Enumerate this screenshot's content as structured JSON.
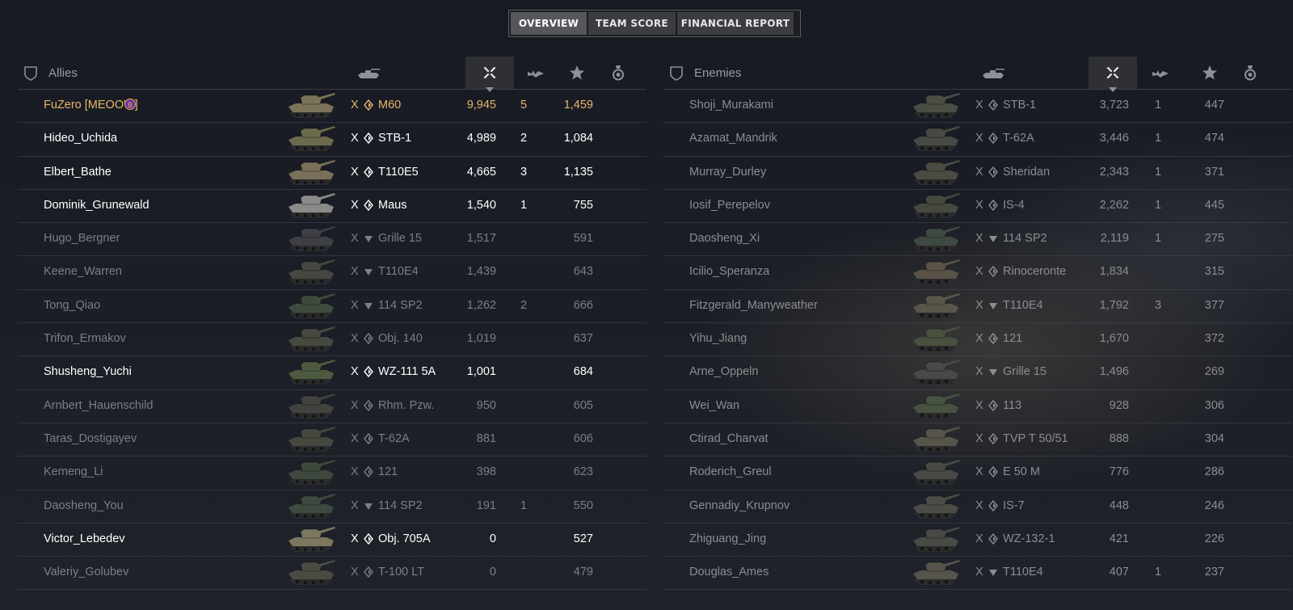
{
  "tabs": [
    {
      "label": "OVERVIEW",
      "active": true
    },
    {
      "label": "TEAM SCORE",
      "active": false
    },
    {
      "label": "FINANCIAL REPORT",
      "active": false
    }
  ],
  "allies": {
    "title": "Allies",
    "rows": [
      {
        "name": "FuZero [MEOOW]",
        "tier": "X",
        "vehicle": "M60",
        "damage": "9,945",
        "kills": "5",
        "xp": "1,459",
        "state": "player",
        "cls": "diamond",
        "camo": "#7a7358"
      },
      {
        "name": "Hideo_Uchida",
        "tier": "X",
        "vehicle": "STB-1",
        "damage": "4,989",
        "kills": "2",
        "xp": "1,084",
        "state": "alive",
        "cls": "diamond",
        "camo": "#6b6a4c"
      },
      {
        "name": "Elbert_Bathe",
        "tier": "X",
        "vehicle": "T110E5",
        "damage": "4,665",
        "kills": "3",
        "xp": "1,135",
        "state": "alive",
        "cls": "diamond",
        "camo": "#7a6f58"
      },
      {
        "name": "Dominik_Grunewald",
        "tier": "X",
        "vehicle": "Maus",
        "damage": "1,540",
        "kills": "1",
        "xp": "755",
        "state": "alive",
        "cls": "diamond",
        "camo": "#8a8a88"
      },
      {
        "name": "Hugo_Bergner",
        "tier": "X",
        "vehicle": "Grille 15",
        "damage": "1,517",
        "kills": "",
        "xp": "591",
        "state": "dead",
        "cls": "triangle",
        "camo": "#3e3f45"
      },
      {
        "name": "Keene_Warren",
        "tier": "X",
        "vehicle": "T110E4",
        "damage": "1,439",
        "kills": "",
        "xp": "643",
        "state": "dead",
        "cls": "triangle",
        "camo": "#464740"
      },
      {
        "name": "Tong_Qiao",
        "tier": "X",
        "vehicle": "114 SP2",
        "damage": "1,262",
        "kills": "2",
        "xp": "666",
        "state": "dead",
        "cls": "triangle",
        "camo": "#3f4a3e"
      },
      {
        "name": "Trifon_Ermakov",
        "tier": "X",
        "vehicle": "Obj. 140",
        "damage": "1,019",
        "kills": "",
        "xp": "637",
        "state": "dead",
        "cls": "diamond",
        "camo": "#46493f"
      },
      {
        "name": "Shusheng_Yuchi",
        "tier": "X",
        "vehicle": "WZ-111 5A",
        "damage": "1,001",
        "kills": "",
        "xp": "684",
        "state": "alive",
        "cls": "diamond",
        "camo": "#4d5a3f"
      },
      {
        "name": "Arnbert_Hauenschild",
        "tier": "X",
        "vehicle": "Rhm. Pzw.",
        "damage": "950",
        "kills": "",
        "xp": "605",
        "state": "dead",
        "cls": "diamond",
        "camo": "#42433f"
      },
      {
        "name": "Taras_Dostigayev",
        "tier": "X",
        "vehicle": "T-62A",
        "damage": "881",
        "kills": "",
        "xp": "606",
        "state": "dead",
        "cls": "diamond",
        "camo": "#45483f"
      },
      {
        "name": "Kemeng_Li",
        "tier": "X",
        "vehicle": "121",
        "damage": "398",
        "kills": "",
        "xp": "623",
        "state": "dead",
        "cls": "diamond",
        "camo": "#3f483c"
      },
      {
        "name": "Daosheng_You",
        "tier": "X",
        "vehicle": "114 SP2",
        "damage": "191",
        "kills": "1",
        "xp": "550",
        "state": "dead",
        "cls": "triangle",
        "camo": "#3c4a40"
      },
      {
        "name": "Victor_Lebedev",
        "tier": "X",
        "vehicle": "Obj. 705A",
        "damage": "0",
        "kills": "",
        "xp": "527",
        "state": "alive",
        "cls": "diamond",
        "camo": "#7c7860"
      },
      {
        "name": "Valeriy_Golubev",
        "tier": "X",
        "vehicle": "T-100 LT",
        "damage": "0",
        "kills": "",
        "xp": "479",
        "state": "dead",
        "cls": "diamond",
        "camo": "#4a4b43"
      }
    ]
  },
  "enemies": {
    "title": "Enemies",
    "rows": [
      {
        "name": "Shoji_Murakami",
        "tier": "X",
        "vehicle": "STB-1",
        "damage": "3,723",
        "kills": "1",
        "xp": "447",
        "cls": "diamond",
        "camo": "#4a4d44"
      },
      {
        "name": "Azamat_Mandrik",
        "tier": "X",
        "vehicle": "T-62A",
        "damage": "3,446",
        "kills": "1",
        "xp": "474",
        "cls": "diamond",
        "camo": "#474a42"
      },
      {
        "name": "Murray_Durley",
        "tier": "X",
        "vehicle": "Sheridan",
        "damage": "2,343",
        "kills": "1",
        "xp": "371",
        "cls": "diamond",
        "camo": "#4a4b41"
      },
      {
        "name": "Iosif_Perepelov",
        "tier": "X",
        "vehicle": "IS-4",
        "damage": "2,262",
        "kills": "1",
        "xp": "445",
        "cls": "diamond",
        "camo": "#46493f"
      },
      {
        "name": "Daosheng_Xi",
        "tier": "X",
        "vehicle": "114 SP2",
        "damage": "2,119",
        "kills": "1",
        "xp": "275",
        "cls": "triangle",
        "camo": "#3e4a41"
      },
      {
        "name": "Icilio_Speranza",
        "tier": "X",
        "vehicle": "Rinoceronte",
        "damage": "1,834",
        "kills": "",
        "xp": "315",
        "cls": "diamond",
        "camo": "#5a5247"
      },
      {
        "name": "Fitzgerald_Manyweather",
        "tier": "X",
        "vehicle": "T110E4",
        "damage": "1,792",
        "kills": "3",
        "xp": "377",
        "cls": "triangle",
        "camo": "#58564a"
      },
      {
        "name": "Yihu_Jiang",
        "tier": "X",
        "vehicle": "121",
        "damage": "1,670",
        "kills": "",
        "xp": "372",
        "cls": "diamond",
        "camo": "#48513f"
      },
      {
        "name": "Arne_Oppeln",
        "tier": "X",
        "vehicle": "Grille 15",
        "damage": "1,496",
        "kills": "",
        "xp": "269",
        "cls": "triangle",
        "camo": "#484a4a"
      },
      {
        "name": "Wei_Wan",
        "tier": "X",
        "vehicle": "113",
        "damage": "928",
        "kills": "",
        "xp": "306",
        "cls": "diamond",
        "camo": "#475240"
      },
      {
        "name": "Ctirad_Charvat",
        "tier": "X",
        "vehicle": "TVP T 50/51",
        "damage": "888",
        "kills": "",
        "xp": "304",
        "cls": "diamond",
        "camo": "#57544a"
      },
      {
        "name": "Roderich_Greul",
        "tier": "X",
        "vehicle": "E 50 M",
        "damage": "776",
        "kills": "",
        "xp": "286",
        "cls": "diamond",
        "camo": "#484a46"
      },
      {
        "name": "Gennadiy_Krupnov",
        "tier": "X",
        "vehicle": "IS-7",
        "damage": "448",
        "kills": "",
        "xp": "246",
        "cls": "diamond",
        "camo": "#4b4c45"
      },
      {
        "name": "Zhiguang_Jing",
        "tier": "X",
        "vehicle": "WZ-132-1",
        "damage": "421",
        "kills": "",
        "xp": "226",
        "cls": "diamond",
        "camo": "#474a45"
      },
      {
        "name": "Douglas_Ames",
        "tier": "X",
        "vehicle": "T110E4",
        "damage": "407",
        "kills": "1",
        "xp": "237",
        "cls": "triangle",
        "camo": "#56544a"
      }
    ]
  },
  "colors": {
    "player": "#e9b66b",
    "alive": "#ffffff",
    "dead": "#7d7f84",
    "clan_badge": "#6a2fa5"
  }
}
